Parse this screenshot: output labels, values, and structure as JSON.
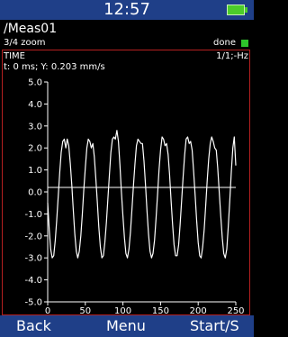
{
  "header": {
    "time": "12:57",
    "battery_icon": "battery-full-icon"
  },
  "measurement": {
    "name": "/Meas01",
    "zoom": "3/4 zoom",
    "status": "done",
    "status_color": "#2ec42a"
  },
  "trace": {
    "type": "TIME",
    "resolution": "1/1;-Hz",
    "cursor_readout": "t: 0 ms; Y: 0.203 mm/s"
  },
  "softkeys": {
    "left": "Back",
    "center": "Menu",
    "right": "Start/S"
  },
  "chart_data": {
    "type": "line",
    "x_ticks": [
      0,
      50,
      100,
      150,
      200,
      250
    ],
    "y_ticks": [
      "5.0",
      "4.0",
      "3.0",
      "2.0",
      "1.0",
      "0.0",
      "-1.0",
      "-2.0",
      "-3.0",
      "-4.0",
      "-5.0"
    ],
    "xlim": [
      0,
      250
    ],
    "ylim": [
      -5,
      5
    ],
    "cursor": {
      "x": 0,
      "y": 0.203
    },
    "series": [
      {
        "color": "#ffffff",
        "x": [
          0,
          2,
          4,
          6,
          8,
          10,
          12,
          14,
          16,
          18,
          20,
          22,
          24,
          26,
          28,
          30,
          32,
          34,
          36,
          38,
          40,
          42,
          44,
          46,
          48,
          50,
          52,
          54,
          56,
          58,
          60,
          62,
          64,
          66,
          68,
          70,
          72,
          74,
          76,
          78,
          80,
          82,
          84,
          86,
          88,
          90,
          92,
          94,
          96,
          98,
          100,
          102,
          104,
          106,
          108,
          110,
          112,
          114,
          116,
          118,
          120,
          122,
          124,
          126,
          128,
          130,
          132,
          134,
          136,
          138,
          140,
          142,
          144,
          146,
          148,
          150,
          152,
          154,
          156,
          158,
          160,
          162,
          164,
          166,
          168,
          170,
          172,
          174,
          176,
          178,
          180,
          182,
          184,
          186,
          188,
          190,
          192,
          194,
          196,
          198,
          200,
          202,
          204,
          206,
          208,
          210,
          212,
          214,
          216,
          218,
          220,
          222,
          224,
          226,
          228,
          230,
          232,
          234,
          236,
          238,
          240,
          242,
          244,
          246,
          248,
          250
        ],
        "values": [
          -0.5,
          -1.7,
          -2.6,
          -3.0,
          -2.9,
          -2.2,
          -1.3,
          -0.2,
          0.9,
          1.8,
          2.3,
          2.4,
          2.0,
          2.4,
          2.1,
          1.3,
          0.3,
          -0.8,
          -1.9,
          -2.7,
          -3.0,
          -2.7,
          -2.0,
          -1.0,
          0.1,
          1.1,
          2.0,
          2.4,
          2.3,
          2.0,
          2.2,
          1.6,
          0.6,
          -0.5,
          -1.6,
          -2.5,
          -3.0,
          -2.9,
          -2.3,
          -1.4,
          -0.3,
          0.8,
          1.8,
          2.4,
          2.5,
          2.4,
          2.8,
          2.3,
          1.2,
          0.0,
          -1.1,
          -2.1,
          -2.8,
          -3.0,
          -2.6,
          -1.8,
          -0.8,
          0.3,
          1.3,
          2.1,
          2.4,
          2.3,
          2.2,
          2.2,
          1.4,
          0.3,
          -0.9,
          -1.9,
          -2.7,
          -3.0,
          -2.8,
          -2.2,
          -1.2,
          -0.1,
          1.0,
          1.9,
          2.5,
          2.4,
          2.1,
          2.2,
          1.7,
          0.8,
          -0.4,
          -1.5,
          -2.4,
          -2.9,
          -2.9,
          -2.4,
          -1.5,
          -0.4,
          0.7,
          1.7,
          2.4,
          2.5,
          2.2,
          2.3,
          1.9,
          0.9,
          -0.2,
          -1.3,
          -2.3,
          -2.9,
          -3.0,
          -2.5,
          -1.7,
          -0.6,
          0.5,
          1.5,
          2.2,
          2.5,
          2.3,
          2.0,
          1.9,
          1.1,
          0.0,
          -1.1,
          -2.1,
          -2.8,
          -3.0,
          -2.6,
          -1.6,
          -0.4,
          0.9,
          2.0,
          2.5,
          1.2
        ]
      }
    ]
  }
}
